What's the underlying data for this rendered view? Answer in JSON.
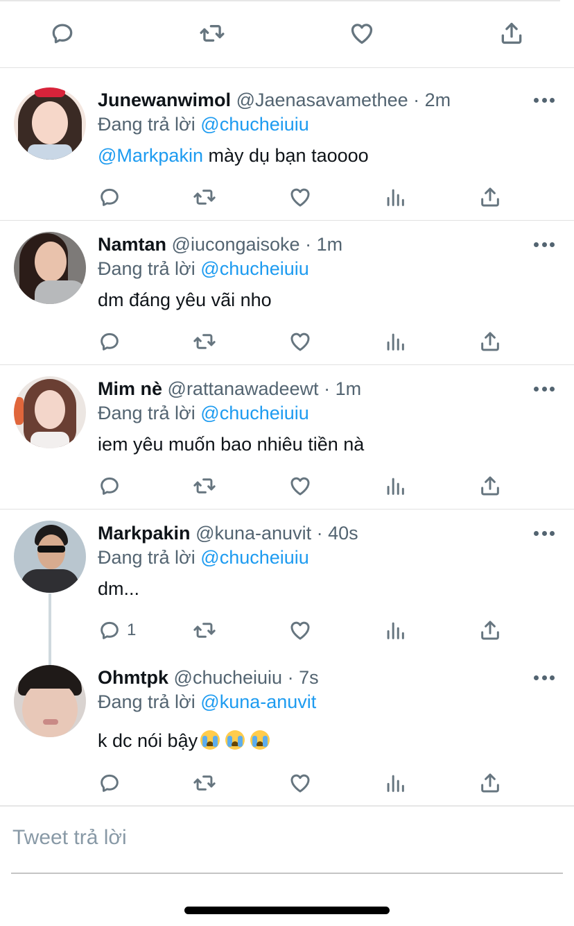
{
  "main_tweet_actions": [
    {
      "name": "reply-icon"
    },
    {
      "name": "retweet-icon"
    },
    {
      "name": "like-icon"
    },
    {
      "name": "share-icon"
    }
  ],
  "replies": [
    {
      "name": "Junewanwimol",
      "handle": "@Jaenasavamethee",
      "dot": "·",
      "time": "2m",
      "replying_prefix": "Đang trả lời",
      "replying_to": "@chucheiuiu",
      "mention": "@Markpakin",
      "text": " mày dụ bạn taoooo",
      "reply_count": ""
    },
    {
      "name": "Namtan",
      "handle": "@iucongaisoke",
      "dot": "·",
      "time": "1m",
      "replying_prefix": "Đang trả lời",
      "replying_to": "@chucheiuiu",
      "text": "dm đáng yêu vãi nho",
      "reply_count": ""
    },
    {
      "name": "Mim nè",
      "handle": "@rattanawadeewt",
      "dot": "·",
      "time": "1m",
      "replying_prefix": "Đang trả lời",
      "replying_to": "@chucheiuiu",
      "text": "iem yêu muốn bao nhiêu tiền nà",
      "reply_count": ""
    },
    {
      "name": "Markpakin",
      "handle": "@kuna-anuvit",
      "dot": "·",
      "time": "40s",
      "replying_prefix": "Đang trả lời",
      "replying_to": "@chucheiuiu",
      "text": "dm...",
      "reply_count": "1"
    },
    {
      "name": "Ohmtpk",
      "handle": "@chucheiuiu",
      "dot": "·",
      "time": "7s",
      "replying_prefix": "Đang trả lời",
      "replying_to": "@kuna-anuvit",
      "text": "k dc nói bậy",
      "emojis": [
        "loudly-crying-face",
        "loudly-crying-face",
        "loudly-crying-face"
      ],
      "reply_count": ""
    }
  ],
  "compose": {
    "placeholder": "Tweet trả lời"
  },
  "colors": {
    "accent": "#1d9bf0",
    "secondary_text": "#536471",
    "icon": "#66757f",
    "divider": "#e1e1e1"
  }
}
